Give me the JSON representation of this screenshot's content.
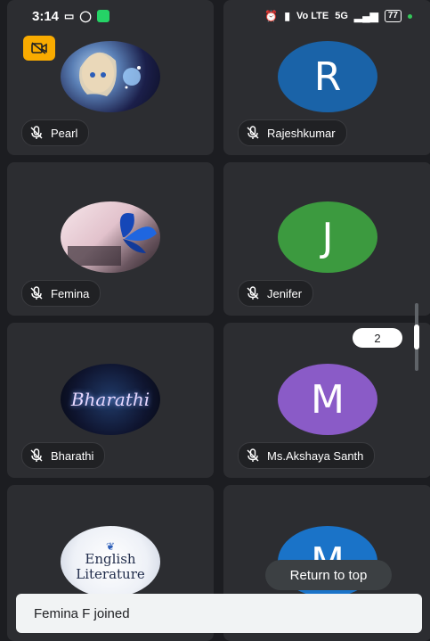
{
  "status_bar": {
    "time": "3:14",
    "network_label": "Vo LTE",
    "signal_label": "5G",
    "battery": "77"
  },
  "participants": [
    {
      "name": "Pearl",
      "avatar": "photo-cartoon-girl"
    },
    {
      "name": "Rajeshkumar",
      "avatar": "letter",
      "initial": "R",
      "color": "#1a63a8"
    },
    {
      "name": "Femina",
      "avatar": "photo-butterfly"
    },
    {
      "name": "Jenifer",
      "avatar": "letter",
      "initial": "J",
      "color": "#3c9a3f"
    },
    {
      "name": "Bharathi",
      "avatar": "photo-bharathi",
      "image_text": "Bharathi"
    },
    {
      "name": "Ms.Akshaya Santh",
      "avatar": "letter",
      "initial": "M",
      "color": "#8a5bc7"
    },
    {
      "name": "",
      "avatar": "photo-english-literature",
      "image_text": "English Literature"
    },
    {
      "name": "",
      "avatar": "letter",
      "initial": "M",
      "color": "#1a73c8"
    }
  ],
  "page_badge": "2",
  "return_top_label": "Return to top",
  "toast_text": "Femina F joined"
}
